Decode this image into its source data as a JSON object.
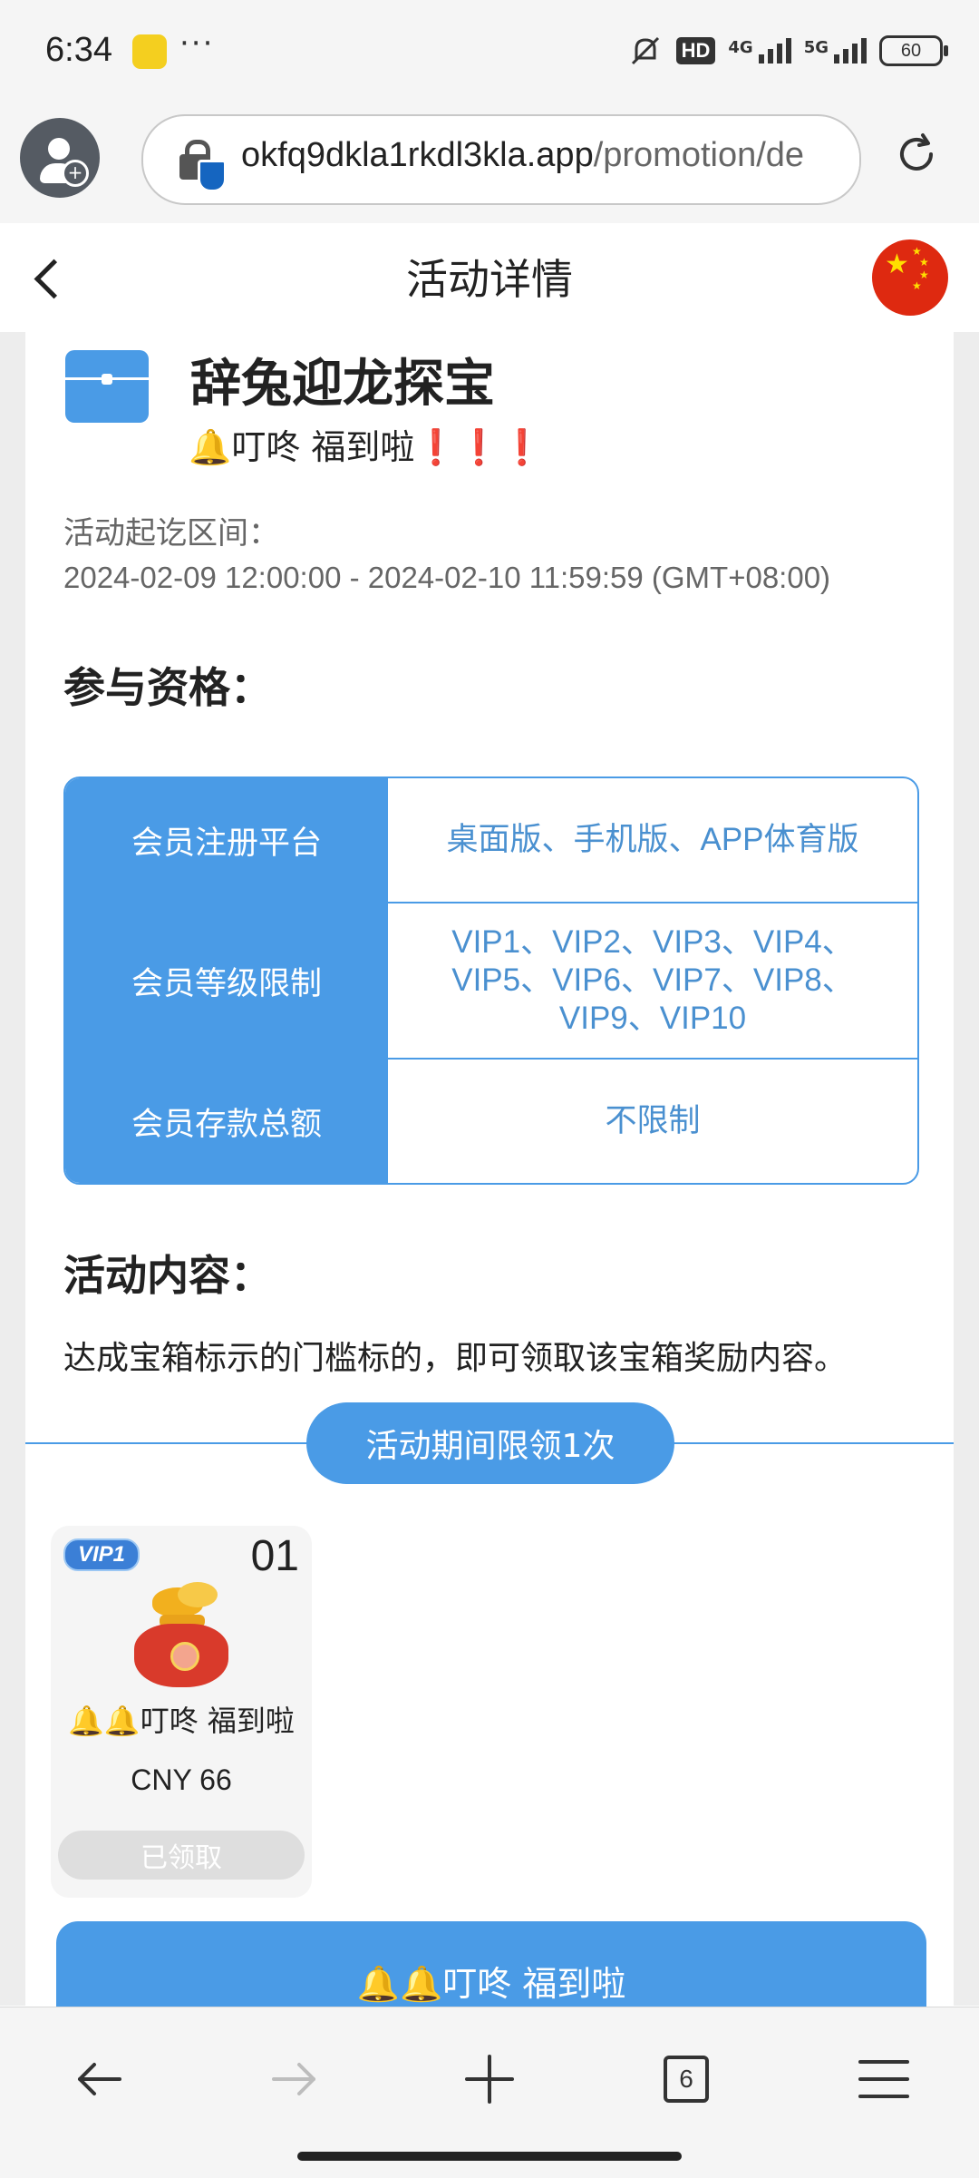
{
  "status_bar": {
    "time": "6:34",
    "more": "···",
    "hd_badge": "HD",
    "net_4g": "4G",
    "net_5g": "5G",
    "battery": "60"
  },
  "browser": {
    "url_host": "okfq9dkla1rkdl3kla.app",
    "url_path": "/promotion/de",
    "tab_count": "6",
    "colors": {
      "accent": "#4a9be6",
      "chrome_bg": "#f5f5f5"
    }
  },
  "header": {
    "title": "活动详情",
    "flag": "china-flag-icon"
  },
  "promo": {
    "title": "辞兔迎龙探宝",
    "subtitle": "🔔叮咚 福到啦❗❗❗",
    "period_label": "活动起讫区间：",
    "period_value": "2024-02-09 12:00:00 - 2024-02-10 11:59:59 (GMT+08:00)"
  },
  "eligibility": {
    "heading": "参与资格：",
    "rows": [
      {
        "label": "会员注册平台",
        "value": "桌面版、手机版、APP体育版"
      },
      {
        "label": "会员等级限制",
        "value_lines": [
          "VIP1、VIP2、VIP3、VIP4、",
          "VIP5、VIP6、VIP7、VIP8、",
          "VIP9、VIP10"
        ]
      },
      {
        "label": "会员存款总额",
        "value": "不限制"
      }
    ]
  },
  "content": {
    "heading": "活动内容：",
    "text": "达成宝箱标示的门槛标的，即可领取该宝箱奖励内容。",
    "limit_pill": "活动期间限领1次"
  },
  "reward": {
    "vip": "VIP1",
    "number": "01",
    "name": "🔔🔔叮咚 福到啦",
    "amount": "CNY 66",
    "status": "已领取",
    "image": "lucky-bag-icon"
  },
  "action_button": "🔔🔔叮咚 福到啦"
}
